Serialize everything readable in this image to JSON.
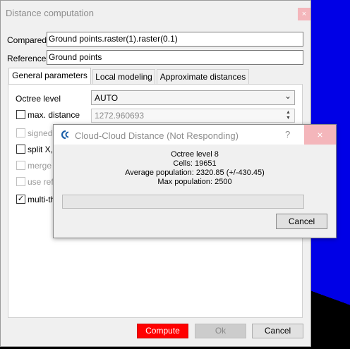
{
  "main_dialog": {
    "title": "Distance computation",
    "close_glyph": "×",
    "compared_label": "Compared",
    "compared_value": "Ground points.raster(1).raster(0.1)",
    "reference_label": "Reference",
    "reference_value": "Ground points",
    "tabs": [
      "General parameters",
      "Local modeling",
      "Approximate distances"
    ],
    "active_tab": 0,
    "octree_label": "Octree level",
    "octree_value": "AUTO",
    "max_distance_label": "max. distance",
    "max_distance_value": "1272.960693",
    "checkboxes": [
      {
        "label": "signed distances",
        "visible_label": "signed d",
        "checked": false,
        "enabled": false
      },
      {
        "label": "split X,Y,Z",
        "visible_label": "split X,Y",
        "checked": false,
        "enabled": true
      },
      {
        "label": "merge X",
        "visible_label": "merge X",
        "checked": false,
        "enabled": false
      },
      {
        "label": "use reference",
        "visible_label": "use refe",
        "checked": false,
        "enabled": false
      },
      {
        "label": "multi-threaded",
        "visible_label": "multi-thr",
        "checked": true,
        "enabled": true
      }
    ],
    "buttons": {
      "compute": "Compute",
      "ok": "Ok",
      "cancel": "Cancel"
    },
    "colors": {
      "compute_bg": "#ff0000",
      "close_bg": "#f4b6bb"
    }
  },
  "progress_dialog": {
    "title": "Cloud-Cloud Distance (Not Responding)",
    "help_glyph": "?",
    "close_glyph": "×",
    "lines": [
      "Octree level 8",
      "Cells: 19651",
      "Average population: 2320.85 (+/-430.45)",
      "Max population: 2500"
    ],
    "progress": 0,
    "cancel": "Cancel",
    "icon": "cloudcompare-logo-icon"
  },
  "desktop": {
    "accent": "#0000e6"
  }
}
